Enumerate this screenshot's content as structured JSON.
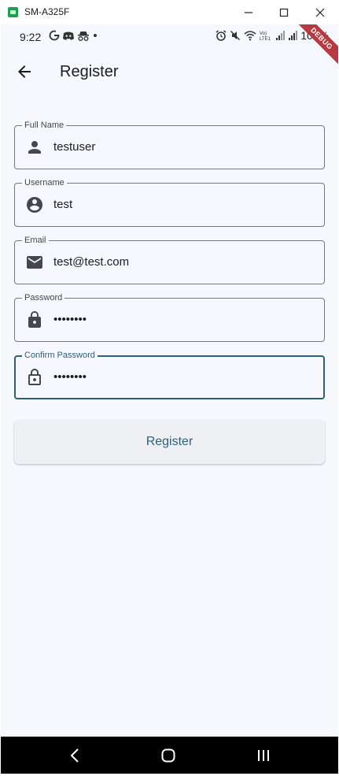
{
  "window": {
    "title": "SM-A325F",
    "controls": [
      "minimize-icon",
      "maximize-icon",
      "close-icon"
    ]
  },
  "status_bar": {
    "time": "9:22",
    "left_icons": [
      "google-icon",
      "discord-icon",
      "incognito-icon",
      "dot-icon"
    ],
    "right_icons": [
      "alarm-icon",
      "mute-icon",
      "wifi-icon",
      "volte-icon",
      "signal-icon",
      "signal-icon"
    ],
    "battery": "100%"
  },
  "debug_banner": "DEBUG",
  "app_bar": {
    "title": "Register",
    "back_icon": "arrow-back-icon"
  },
  "form": {
    "full_name": {
      "label": "Full Name",
      "value": "testuser",
      "icon": "person-icon"
    },
    "username": {
      "label": "Username",
      "value": "test",
      "icon": "account-circle-icon"
    },
    "email": {
      "label": "Email",
      "value": "test@test.com",
      "icon": "email-icon"
    },
    "password": {
      "label": "Password",
      "value": "••••••••",
      "icon": "lock-icon"
    },
    "confirm_password": {
      "label": "Confirm Password",
      "value": "••••••••",
      "icon": "lock-open-icon",
      "focused": true
    }
  },
  "register_button": {
    "label": "Register"
  },
  "nav_bar": [
    "back-nav-icon",
    "home-nav-icon",
    "recents-nav-icon"
  ],
  "colors": {
    "background": "#f7f8fd",
    "primary": "#2d5f7d",
    "outline": "#74777f",
    "debug": "#b8393f"
  }
}
